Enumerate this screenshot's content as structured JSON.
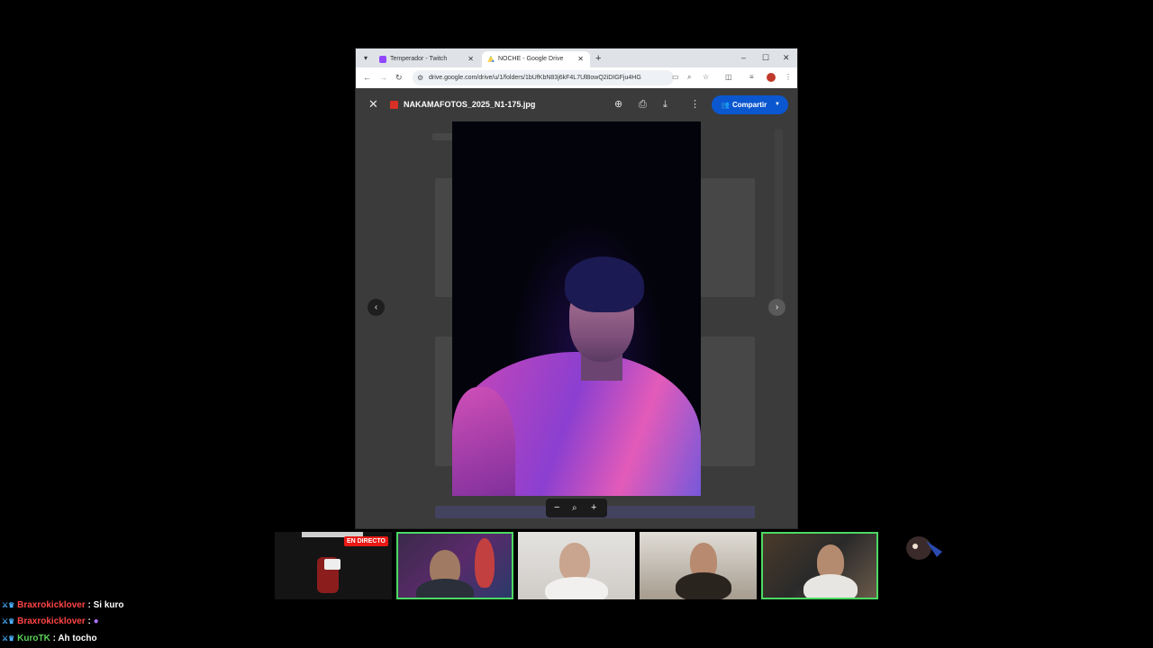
{
  "browser": {
    "tabs": [
      {
        "title": "Temperador - Twitch"
      },
      {
        "title": "NOCHE - Google Drive"
      }
    ],
    "url": "drive.google.com/drive/u/1/folders/1bUfKbN83j6kF4L7UlBowQ2iDIGFju4HG"
  },
  "viewer": {
    "filename": "NAKAMAFOTOS_2025_N1-175.jpg",
    "share_label": "Compartir"
  },
  "stream": {
    "live_badge": "EN DIRECTO"
  },
  "chat": [
    {
      "user": "Braxrokicklover",
      "message": "Si kuro"
    },
    {
      "user": "Braxrokicklover",
      "message": ":"
    },
    {
      "user": "KuroTK",
      "message": "Ah tocho"
    }
  ],
  "colors": {
    "accent": "#0b57d0",
    "live": "#e91916",
    "active_border": "#4cd964",
    "chat_user_red": "#ff4545",
    "chat_user_green": "#5ad05a"
  }
}
